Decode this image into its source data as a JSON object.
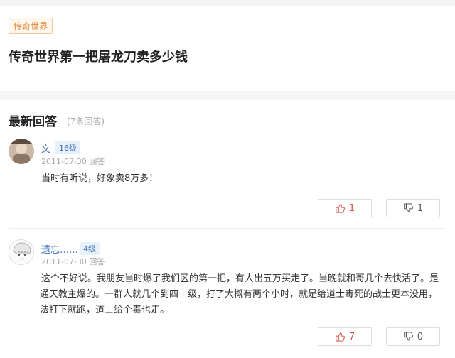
{
  "question": {
    "tag": "传奇世界",
    "title": "传奇世界第一把屠龙刀卖多少钱"
  },
  "answers_section": {
    "title": "最新回答",
    "count": "(7条回答)"
  },
  "answers": [
    {
      "user": "文",
      "level": "16级",
      "meta": "2011-07-30 回答",
      "text": "当时有听说，好象卖8万多！",
      "upvotes": "1",
      "downvotes": "1"
    },
    {
      "user": "遗忘……",
      "level": "4级",
      "meta": "2011-07-30 回答",
      "text_lines": [
        "这个不好说。我朋友当时爆了我们区的第一把，有人出五万买走了。当晚就和哥几个去快活了。是",
        "通天教主爆的。一群人就几个到四十级，打了大概有两个小时，就是给道士毒死的战士更本没用，",
        "法打下就跑，道士给个毒也走。"
      ],
      "upvotes": "7",
      "downvotes": "0"
    }
  ],
  "colors": {
    "tag": "#e08a3c",
    "username": "#3b6fb6",
    "upvote": "#d9534f"
  },
  "icons": [
    "thumb-up-icon",
    "thumb-down-icon"
  ]
}
